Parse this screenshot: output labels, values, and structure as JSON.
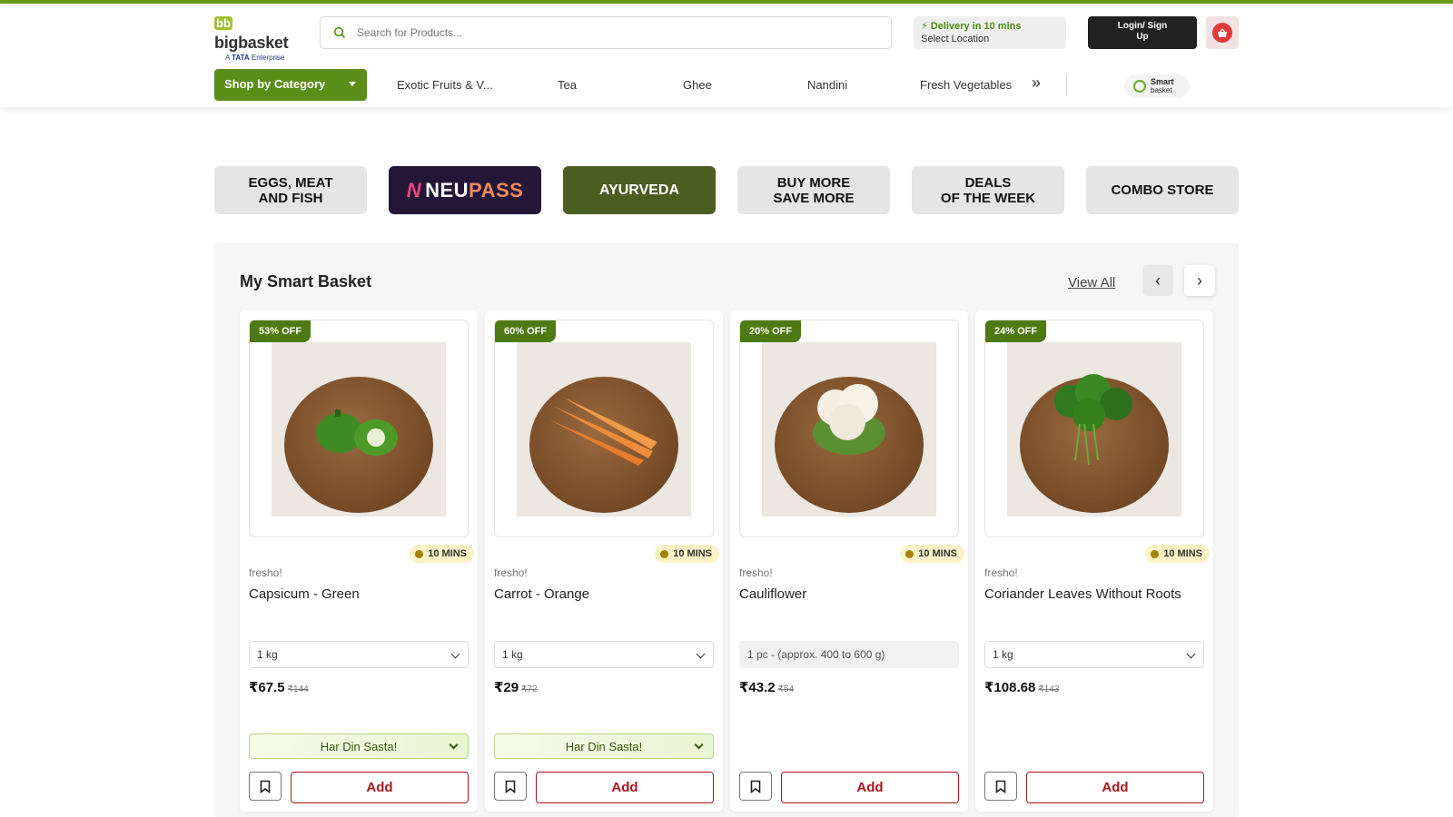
{
  "header": {
    "logo_text": "bigbasket",
    "logo_bb": "bb",
    "logo_tagline_prefix": "A",
    "logo_tagline_brand": "TATA",
    "logo_tagline_suffix": "Enterprise",
    "search_placeholder": "Search for Products...",
    "delivery_title": "Delivery in 10 mins",
    "delivery_location": "Select Location",
    "login_label_line1": "Login/ Sign",
    "login_label_line2": "Up",
    "shop_by_category": "Shop by Category",
    "nav_links": [
      "Exotic Fruits & V...",
      "Tea",
      "Ghee",
      "Nandini",
      "Fresh Vegetables"
    ],
    "nav_more": "»",
    "smart_basket_l1": "Smart",
    "smart_basket_l2": "basket"
  },
  "tiles": [
    {
      "line1": "EGGS, MEAT",
      "line2": "AND FISH"
    },
    {
      "neu_mark": "N",
      "neu": "NEU",
      "pass": "PASS"
    },
    {
      "line1": "AYURVEDA"
    },
    {
      "line1": "BUY MORE",
      "line2": "SAVE MORE"
    },
    {
      "line1": "DEALS",
      "line2": "OF THE WEEK"
    },
    {
      "line1": "COMBO STORE"
    }
  ],
  "section": {
    "title": "My Smart Basket",
    "view_all": "View All",
    "prev": "‹",
    "next": "›"
  },
  "products": [
    {
      "badge": "53% OFF",
      "mins": "10 MINS",
      "brand": "fresho!",
      "name": "Capsicum - Green",
      "qty": "1 kg",
      "price": "₹67.5",
      "mrp": "₹144",
      "offer": "Har Din Sasta!",
      "add": "Add",
      "color": "#3f8a22"
    },
    {
      "badge": "60% OFF",
      "mins": "10 MINS",
      "brand": "fresho!",
      "name": "Carrot - Orange",
      "qty": "1 kg",
      "price": "₹29",
      "mrp": "₹72",
      "offer": "Har Din Sasta!",
      "add": "Add",
      "color": "#ee8a3c"
    },
    {
      "badge": "20% OFF",
      "mins": "10 MINS",
      "brand": "fresho!",
      "name": "Cauliflower",
      "qty": "1 pc - (approx. 400 to 600 g)",
      "price": "₹43.2",
      "mrp": "₹54",
      "add": "Add",
      "color": "#f2ede0"
    },
    {
      "badge": "24% OFF",
      "mins": "10 MINS",
      "brand": "fresho!",
      "name": "Coriander Leaves Without Roots",
      "qty": "1 kg",
      "price": "₹108.68",
      "mrp": "₹143",
      "add": "Add",
      "color": "#2f7a1e"
    }
  ]
}
